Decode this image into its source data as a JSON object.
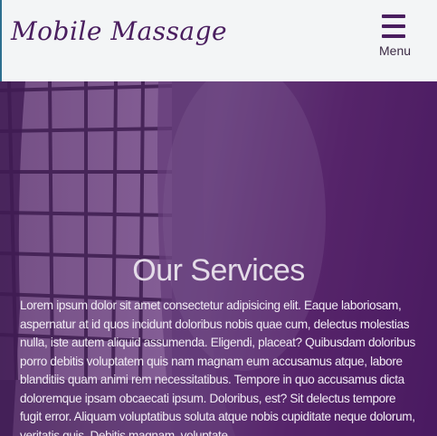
{
  "header": {
    "logo_text": "Mobile Massage",
    "menu_label": "Menu"
  },
  "hero": {
    "title": "Our Services",
    "body": "Lorem ipsum dolor sit amet consectetur adipisicing elit. Eaque laboriosam, aspernatur at id quos incidunt doloribus nobis quae cum, delectus molestias nulla, iste autem aliquid assumenda. Eligendi, placeat? Quibusdam doloribus porro debitis voluptatem quis nam magnam eum accusamus atque, labore blanditiis quam animi rem necessitatibus. Tempore in quo accusamus dicta doloremque ipsam obcaecati ipsum. Doloribus, est? Sit delectus tempore fugit error. Aliquam voluptatibus soluta atque nobis cupiditate neque dolorum, veritatis quis. Debitis magnam, voluptate"
  },
  "colors": {
    "brand": "#4a1e5f",
    "header_bg": "#f3f5f6",
    "hero_overlay": "#5b2a6f"
  }
}
